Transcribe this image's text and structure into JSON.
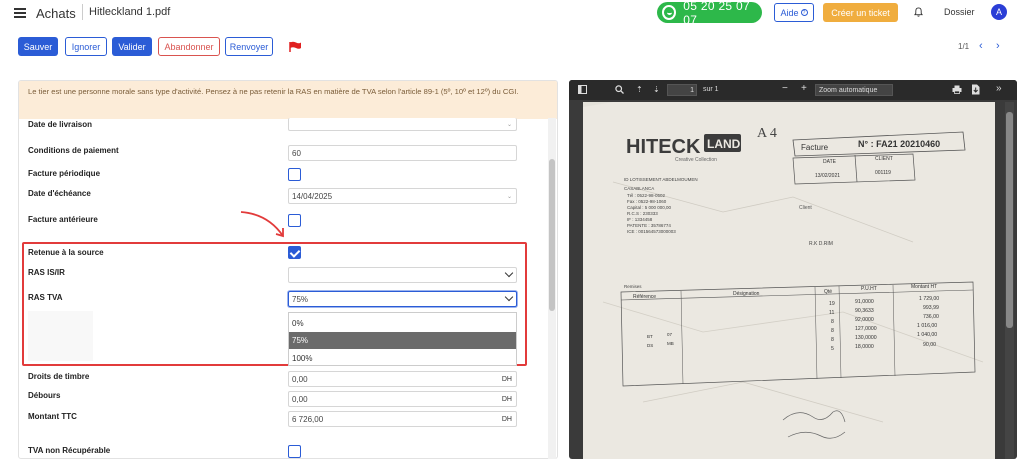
{
  "header": {
    "app_title": "Achats",
    "file_name": "Hitleckland 1.pdf",
    "phone": "05 20 25 07 07",
    "help_label": "Aide",
    "ticket_label": "Créer un ticket",
    "dossier_label": "Dossier",
    "avatar_initial": "A"
  },
  "toolbar": {
    "save_label": "Sauver",
    "ignore_label": "Ignorer",
    "validate_label": "Valider",
    "abandon_label": "Abandonner",
    "resend_label": "Renvoyer",
    "pager": "1/1"
  },
  "alert": {
    "text": "Le tier est une personne morale sans type d'activité. Pensez à ne pas retenir la RAS en matière de TVA selon l'article 89-1 (5º, 10º et 12º) du CGI."
  },
  "form": {
    "date_livraison_label": "Date de livraison",
    "conditions_label": "Conditions de paiement",
    "conditions_value": "60",
    "facture_periodique_label": "Facture périodique",
    "date_echeance_label": "Date d'échéance",
    "date_echeance_value": "14/04/2025",
    "facture_anterieure_label": "Facture antérieure",
    "retenue_label": "Retenue à la source",
    "ras_isir_label": "RAS IS/IR",
    "ras_tva_label": "RAS TVA",
    "ras_tva_value": "75%",
    "ras_tva_options": [
      "0%",
      "75%",
      "100%"
    ],
    "droits_label": "Droits de timbre",
    "droits_value": "0,00",
    "debours_label": "Débours",
    "debours_value": "0,00",
    "montant_label": "Montant TTC",
    "montant_value": "6 726,00",
    "tva_label": "TVA non Récupérable",
    "currency": "DH"
  },
  "pdf_viewer": {
    "page_input": "1",
    "page_total": "sur 1",
    "zoom_label": "Zoom automatique",
    "document": {
      "brand": "HITECK",
      "brand_box": "LAND",
      "brand_tagline": "Creative Collection",
      "facture_label": "Facture",
      "facture_number": "N° : FA21 20210460",
      "date_label": "DATE",
      "date_value": "13/02/2021",
      "client_label": "CLIENT",
      "client_value": "001119",
      "handwritten_top": "A 4",
      "address_lines": [
        "ID LOTISSEMENT ABDELMOUMEN",
        "CASABLANCA",
        "Tél : 0522-98-0502",
        "Fax : 0522-98-1060",
        "Capital : 5 000 000,00",
        "R.C.S : 230333",
        "IF : 1334458",
        "PATENTE : 35786774",
        "ICE : 001564573000003"
      ],
      "client_side": "Client",
      "client_name": "R.K D.RIM",
      "table_headers": [
        "Référence",
        "Désignation",
        "Qté",
        "P.U.HT",
        "Montant HT"
      ],
      "table_qty": [
        "19",
        "11",
        "8",
        "8",
        "8",
        "5"
      ],
      "table_pu": [
        "91,0000",
        "90,3633",
        "92,0000",
        "127,0000",
        "130,0000",
        "18,0000"
      ],
      "table_amount": [
        "1 729,00",
        "993,99",
        "736,00",
        "1 016,00",
        "1 040,00",
        "90,00"
      ],
      "refs": [
        "BT",
        "DS",
        "07",
        "MB"
      ],
      "remises_label": "Remises"
    }
  },
  "colors": {
    "primary": "#2b5cd6",
    "danger": "#d9534f",
    "phone_green": "#2db84a",
    "ticket_orange": "#f0ad3e",
    "highlight_red": "#e23b3b",
    "alert_bg": "#fcecd8"
  }
}
